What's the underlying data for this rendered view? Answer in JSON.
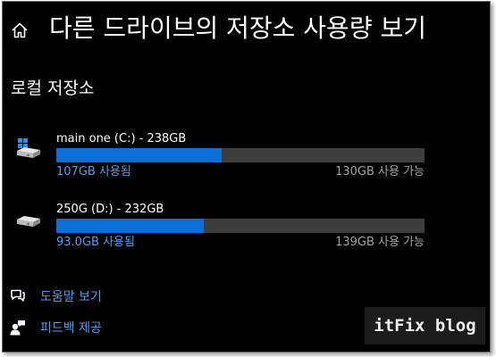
{
  "header": {
    "title": "다른 드라이브의 저장소 사용량 보기",
    "home_icon": "home-icon"
  },
  "section": {
    "title": "로컬 저장소"
  },
  "drives": [
    {
      "name": "main one (C:) - 238GB",
      "used_label": "107GB 사용됨",
      "free_label": "130GB 사용 가능",
      "used_fraction": 0.45,
      "icon": "windows-drive-icon"
    },
    {
      "name": "250G (D:) - 232GB",
      "used_label": "93.0GB 사용됨",
      "free_label": "139GB 사용 가능",
      "used_fraction": 0.4,
      "icon": "drive-icon"
    }
  ],
  "links": {
    "help": "도움말 보기",
    "feedback": "피드백 제공"
  },
  "watermark": "itFix blog",
  "colors": {
    "background": "#000000",
    "accent": "#0a6fd8",
    "link": "#4c9ff0",
    "bar_track": "#3d3d3d",
    "muted_text": "#a0a0a0"
  }
}
